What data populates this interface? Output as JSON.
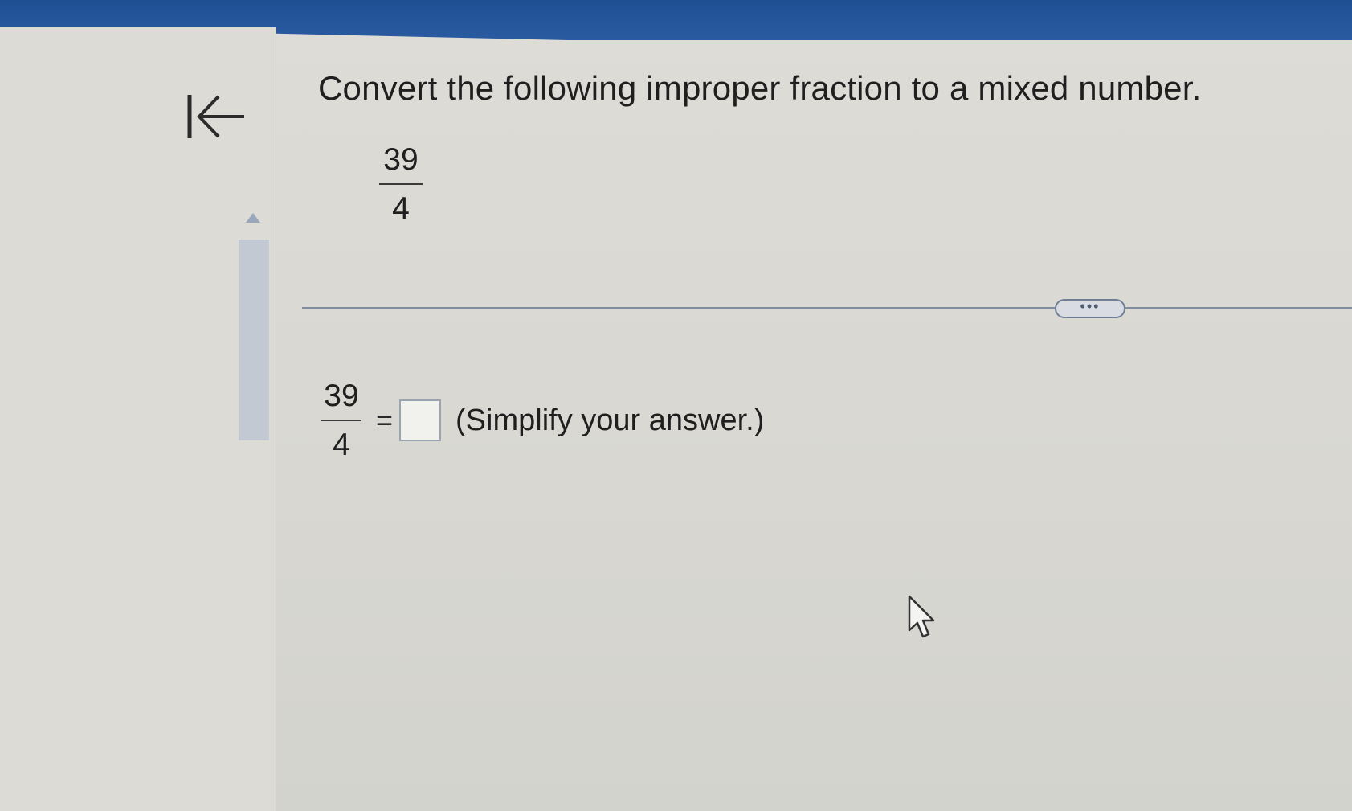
{
  "question": {
    "prompt": "Convert the following improper fraction to a mixed number.",
    "fraction": {
      "numerator": "39",
      "denominator": "4"
    }
  },
  "answer": {
    "fraction": {
      "numerator": "39",
      "denominator": "4"
    },
    "equals": "=",
    "input_value": "",
    "hint": "(Simplify your answer.)"
  },
  "more_button": {
    "label": "•••"
  },
  "icons": {
    "back": "back-to-start-icon",
    "scroll_up": "scroll-up-arrow-icon",
    "pointer": "mouse-pointer-icon"
  },
  "colors": {
    "header": "#1f4f93",
    "divider": "#7f8d9f",
    "text": "#1f1f1f"
  }
}
